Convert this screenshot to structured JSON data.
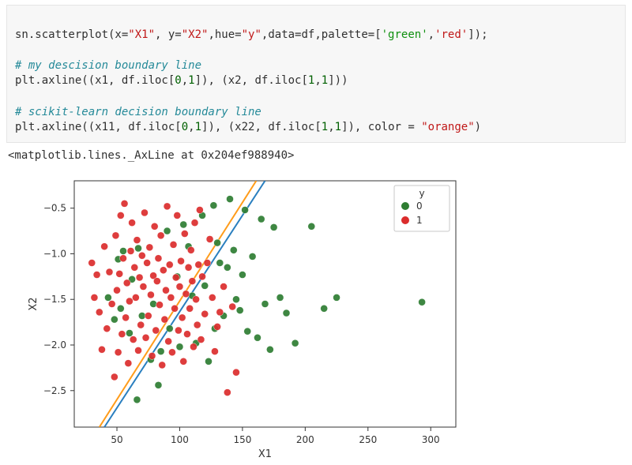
{
  "code": {
    "line1": {
      "pre": "sn.scatterplot(x=",
      "x": "\"X1\"",
      "mid1": ", y=",
      "y": "\"X2\"",
      "mid2": ",hue=",
      "hue": "\"y\"",
      "mid3": ",data=df,palette=[",
      "palette_green": "'green'",
      "comma": ",",
      "palette_red": "'red'",
      "end": "]);"
    },
    "comment1": "# my descision boundary line",
    "line2_a": "plt.axline((x1, df.iloc[",
    "line2_n0": "0",
    "line2_m1": ",",
    "line2_n1": "1",
    "line2_b": "]), (x2, df.iloc[",
    "line2_n2": "1",
    "line2_m2": ",",
    "line2_n3": "1",
    "line2_c": "]))",
    "comment2": "# scikit-learn decision boundary line",
    "line3_a": "plt.axline((x11, df.iloc[",
    "line3_n0": "0",
    "line3_m1": ",",
    "line3_n1": "1",
    "line3_b": "]), (x22, df.iloc[",
    "line3_n2": "1",
    "line3_m2": ",",
    "line3_n3": "1",
    "line3_c": "]), color = ",
    "line3_color": "\"orange\"",
    "line3_d": ")"
  },
  "output_repr": "<matplotlib.lines._AxLine at 0x204ef988940>",
  "chart_data": {
    "type": "scatter",
    "title": "",
    "xlabel": "X1",
    "ylabel": "X2",
    "xlim": [
      16,
      320
    ],
    "ylim": [
      -2.9,
      -0.2
    ],
    "xticks": [
      50,
      100,
      150,
      200,
      250,
      300
    ],
    "yticks": [
      -0.5,
      -1.0,
      -1.5,
      -2.0,
      -2.5
    ],
    "legend": {
      "title": "y",
      "entries": [
        {
          "label": "0",
          "color": "#2E7D32"
        },
        {
          "label": "1",
          "color": "#DB2C2C"
        }
      ]
    },
    "series": [
      {
        "name": "0",
        "color": "#2E7D32",
        "points": [
          [
            43,
            -1.48
          ],
          [
            48,
            -1.72
          ],
          [
            51,
            -1.06
          ],
          [
            53,
            -1.6
          ],
          [
            55,
            -0.97
          ],
          [
            60,
            -1.87
          ],
          [
            62,
            -1.28
          ],
          [
            66,
            -2.6
          ],
          [
            67,
            -0.94
          ],
          [
            70,
            -1.68
          ],
          [
            77,
            -2.16
          ],
          [
            79,
            -1.55
          ],
          [
            83,
            -2.44
          ],
          [
            85,
            -2.07
          ],
          [
            90,
            -0.75
          ],
          [
            92,
            -1.82
          ],
          [
            98,
            -1.25
          ],
          [
            100,
            -2.02
          ],
          [
            103,
            -0.68
          ],
          [
            107,
            -0.92
          ],
          [
            110,
            -1.46
          ],
          [
            113,
            -1.98
          ],
          [
            118,
            -0.58
          ],
          [
            120,
            -1.35
          ],
          [
            123,
            -2.18
          ],
          [
            127,
            -0.47
          ],
          [
            128,
            -1.82
          ],
          [
            130,
            -0.88
          ],
          [
            132,
            -1.1
          ],
          [
            135,
            -1.68
          ],
          [
            138,
            -1.15
          ],
          [
            140,
            -0.4
          ],
          [
            143,
            -0.96
          ],
          [
            145,
            -1.5
          ],
          [
            148,
            -1.62
          ],
          [
            150,
            -1.23
          ],
          [
            152,
            -0.52
          ],
          [
            154,
            -1.85
          ],
          [
            158,
            -1.03
          ],
          [
            162,
            -1.92
          ],
          [
            165,
            -0.62
          ],
          [
            168,
            -1.55
          ],
          [
            172,
            -2.05
          ],
          [
            175,
            -0.71
          ],
          [
            180,
            -1.48
          ],
          [
            185,
            -1.65
          ],
          [
            192,
            -1.98
          ],
          [
            205,
            -0.7
          ],
          [
            215,
            -1.6
          ],
          [
            225,
            -1.48
          ],
          [
            293,
            -1.53
          ]
        ]
      },
      {
        "name": "1",
        "color": "#DB2C2C",
        "points": [
          [
            30,
            -1.1
          ],
          [
            32,
            -1.48
          ],
          [
            34,
            -1.23
          ],
          [
            36,
            -1.64
          ],
          [
            38,
            -2.05
          ],
          [
            40,
            -0.92
          ],
          [
            42,
            -1.82
          ],
          [
            44,
            -1.2
          ],
          [
            46,
            -1.55
          ],
          [
            48,
            -2.35
          ],
          [
            49,
            -0.8
          ],
          [
            50,
            -1.4
          ],
          [
            51,
            -2.08
          ],
          [
            52,
            -1.22
          ],
          [
            53,
            -0.58
          ],
          [
            54,
            -1.88
          ],
          [
            55,
            -1.05
          ],
          [
            56,
            -0.45
          ],
          [
            57,
            -1.7
          ],
          [
            58,
            -1.32
          ],
          [
            59,
            -2.2
          ],
          [
            60,
            -1.52
          ],
          [
            61,
            -0.97
          ],
          [
            62,
            -0.66
          ],
          [
            63,
            -1.94
          ],
          [
            64,
            -1.15
          ],
          [
            65,
            -1.48
          ],
          [
            66,
            -0.85
          ],
          [
            67,
            -2.06
          ],
          [
            68,
            -1.26
          ],
          [
            69,
            -1.78
          ],
          [
            70,
            -1.02
          ],
          [
            71,
            -1.36
          ],
          [
            72,
            -0.55
          ],
          [
            73,
            -1.92
          ],
          [
            74,
            -1.1
          ],
          [
            75,
            -1.68
          ],
          [
            76,
            -0.93
          ],
          [
            77,
            -1.45
          ],
          [
            78,
            -2.12
          ],
          [
            79,
            -1.24
          ],
          [
            80,
            -0.7
          ],
          [
            81,
            -1.84
          ],
          [
            82,
            -1.3
          ],
          [
            83,
            -1.05
          ],
          [
            84,
            -1.56
          ],
          [
            85,
            -0.8
          ],
          [
            86,
            -2.22
          ],
          [
            87,
            -1.18
          ],
          [
            88,
            -1.72
          ],
          [
            89,
            -1.4
          ],
          [
            90,
            -0.48
          ],
          [
            91,
            -1.96
          ],
          [
            92,
            -1.12
          ],
          [
            93,
            -1.48
          ],
          [
            94,
            -2.08
          ],
          [
            95,
            -0.9
          ],
          [
            96,
            -1.6
          ],
          [
            97,
            -1.26
          ],
          [
            98,
            -0.58
          ],
          [
            99,
            -1.84
          ],
          [
            100,
            -1.36
          ],
          [
            101,
            -1.08
          ],
          [
            102,
            -1.7
          ],
          [
            103,
            -2.18
          ],
          [
            104,
            -0.78
          ],
          [
            105,
            -1.44
          ],
          [
            106,
            -1.88
          ],
          [
            107,
            -1.15
          ],
          [
            108,
            -1.6
          ],
          [
            109,
            -0.96
          ],
          [
            110,
            -1.3
          ],
          [
            111,
            -2.02
          ],
          [
            112,
            -0.66
          ],
          [
            113,
            -1.5
          ],
          [
            114,
            -1.78
          ],
          [
            115,
            -1.12
          ],
          [
            116,
            -0.52
          ],
          [
            117,
            -1.94
          ],
          [
            118,
            -1.25
          ],
          [
            120,
            -1.66
          ],
          [
            122,
            -1.1
          ],
          [
            124,
            -0.84
          ],
          [
            126,
            -1.48
          ],
          [
            128,
            -2.07
          ],
          [
            130,
            -1.8
          ],
          [
            132,
            -1.64
          ],
          [
            135,
            -1.36
          ],
          [
            138,
            -2.52
          ],
          [
            142,
            -1.58
          ],
          [
            145,
            -2.3
          ]
        ]
      }
    ],
    "decision_lines": [
      {
        "name": "my-line",
        "color": "#2a7fbf",
        "p1": [
          40,
          -2.9
        ],
        "p2": [
          168,
          -0.2
        ]
      },
      {
        "name": "sklearn-line",
        "color": "#ff9c1a",
        "p1": [
          36,
          -2.9
        ],
        "p2": [
          161,
          -0.2
        ]
      }
    ]
  }
}
